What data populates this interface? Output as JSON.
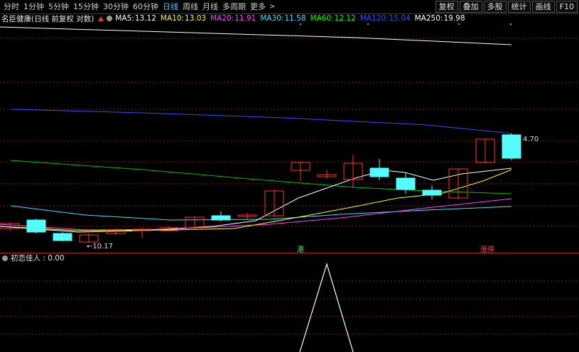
{
  "toolbar": {
    "tabs": [
      {
        "label": "分时",
        "active": false
      },
      {
        "label": "1分钟",
        "active": false
      },
      {
        "label": "5分钟",
        "active": false
      },
      {
        "label": "15分钟",
        "active": false
      },
      {
        "label": "30分钟",
        "active": false
      },
      {
        "label": "60分钟",
        "active": false
      },
      {
        "label": "日线",
        "active": true
      },
      {
        "label": "周线",
        "active": false
      },
      {
        "label": "月线",
        "active": false
      },
      {
        "label": "多周期",
        "active": false
      },
      {
        "label": "更多",
        "active": false
      }
    ],
    "buttons": [
      "复权",
      "叠加",
      "多股",
      "统计",
      "画线",
      "F10"
    ]
  },
  "info": {
    "title": "名臣健康(日线 前复权 对数)",
    "ma": [
      {
        "label": "MA5:",
        "value": "13.12",
        "color": "#ffffff"
      },
      {
        "label": "MA10:",
        "value": "13.03",
        "color": "#ffff00"
      },
      {
        "label": "MA20:",
        "value": "11.91",
        "color": "#ff40ff"
      },
      {
        "label": "MA30:",
        "value": "11.58",
        "color": "#40e0ff"
      },
      {
        "label": "MA60:",
        "value": "12.12",
        "color": "#00ff00"
      },
      {
        "label": "MA120:",
        "value": "15.04",
        "color": "#3050ff"
      },
      {
        "label": "MA250:",
        "value": "19.98",
        "color": "#ffffff"
      }
    ]
  },
  "chart_labels": {
    "high_price": "4.70",
    "low_price": "10.17",
    "marker_left": "港",
    "marker_right": "涨停"
  },
  "sub_indicator": {
    "label": "初恋佳人",
    "value": "0.00"
  },
  "colors": {
    "up": "#ff3030",
    "down": "#54fcfc",
    "grid": "#8b1a1a"
  }
}
